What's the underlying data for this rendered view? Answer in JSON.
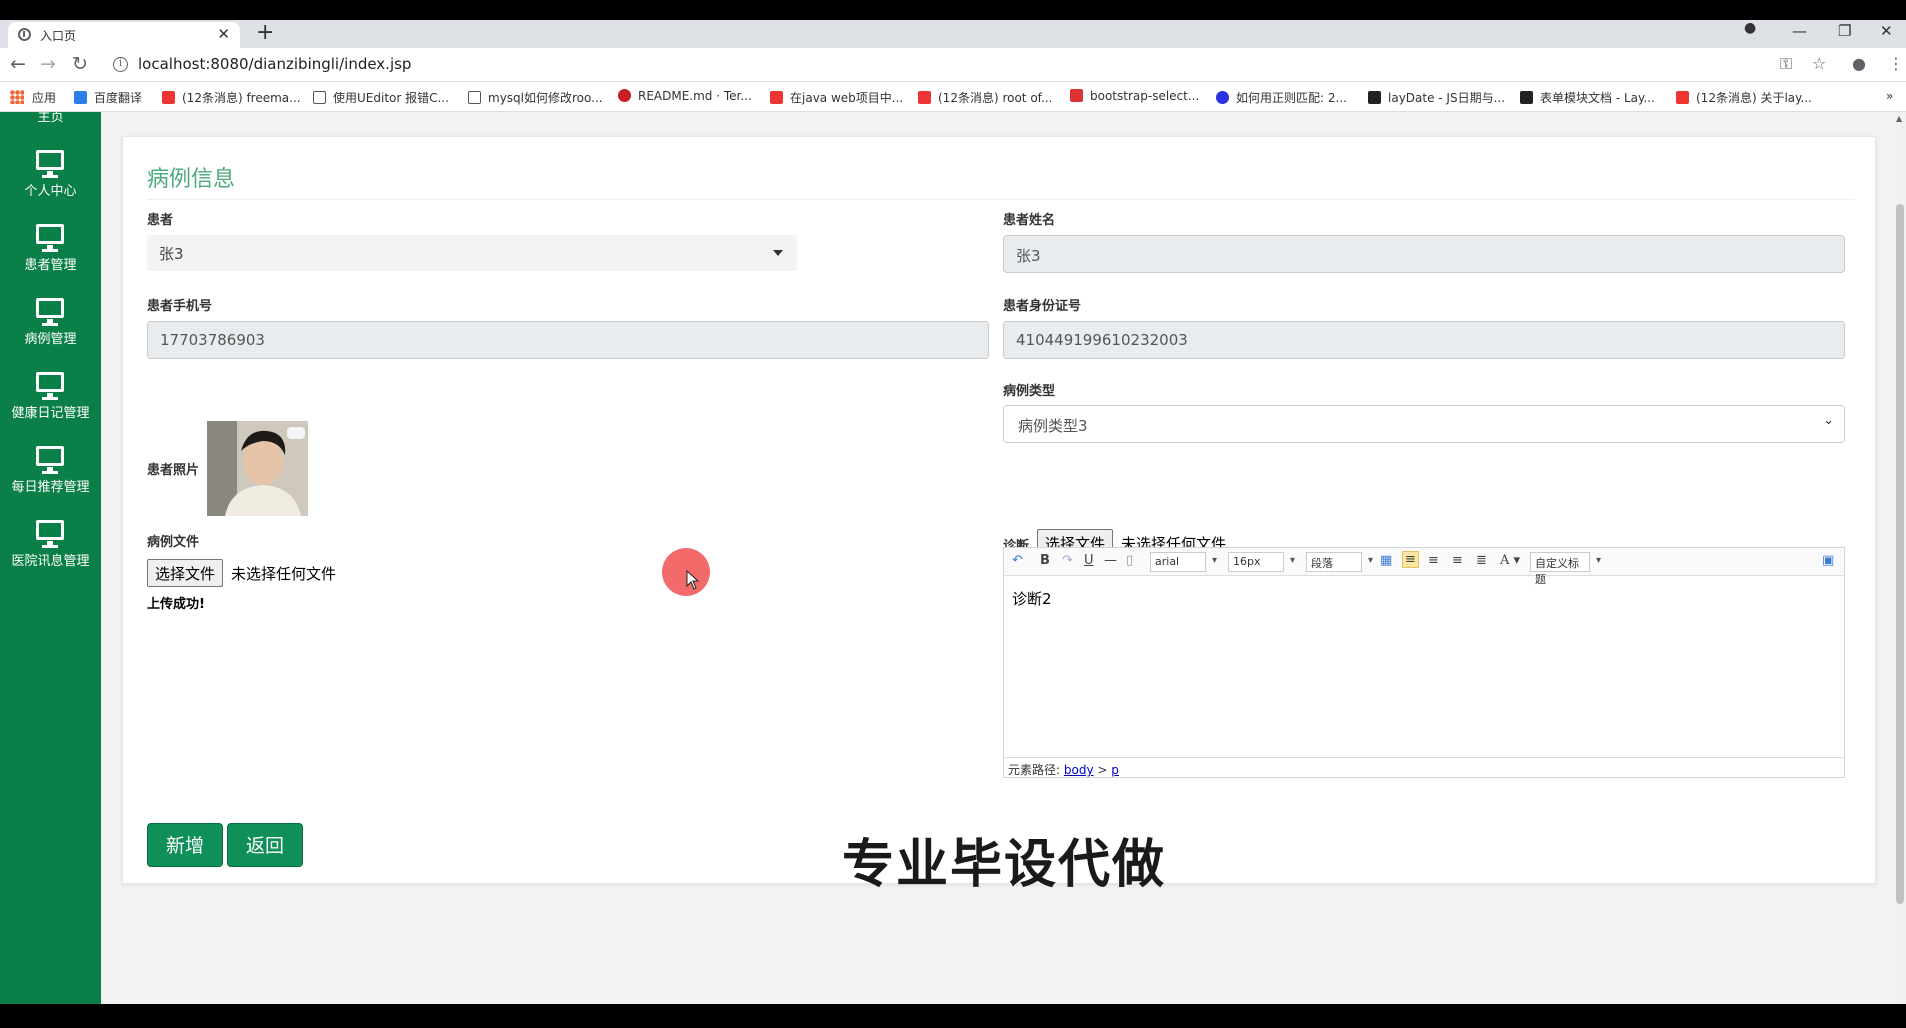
{
  "browser": {
    "tab_title": "入口页",
    "close_glyph": "✕",
    "new_tab_glyph": "+",
    "url": "localhost:8080/dianzibingli/index.jsp",
    "window_controls": [
      "—",
      "❐",
      "✕"
    ],
    "bookmarks": [
      {
        "label": "应用",
        "icon": "apps-icon"
      },
      {
        "label": "百度翻译",
        "icon": "baidu-translate-icon",
        "color": "#2b7de9"
      },
      {
        "label": "(12条消息) freema...",
        "icon": "csdn-icon",
        "color": "#e33"
      },
      {
        "label": "使用UEditor 报错C...",
        "icon": "fork-icon",
        "color": "#555"
      },
      {
        "label": "mysql如何修改roo...",
        "icon": "fork-icon",
        "color": "#555"
      },
      {
        "label": "README.md · Ter...",
        "icon": "gitee-icon",
        "color": "#c71d23"
      },
      {
        "label": "在java web项目中...",
        "icon": "csdn-icon",
        "color": "#e33"
      },
      {
        "label": "(12条消息) root of...",
        "icon": "csdn-icon",
        "color": "#e33"
      },
      {
        "label": "bootstrap-select...",
        "icon": "runoob-icon",
        "color": "#d33"
      },
      {
        "label": "如何用正则匹配: 2...",
        "icon": "baidu-icon",
        "color": "#2932e1"
      },
      {
        "label": "layDate - JS日期与...",
        "icon": "layui-icon",
        "color": "#222"
      },
      {
        "label": "表单模块文档 - Lay...",
        "icon": "layui-icon",
        "color": "#222"
      },
      {
        "label": "(12条消息) 关于lay...",
        "icon": "csdn-icon",
        "color": "#e33"
      }
    ],
    "more_glyph": "»"
  },
  "sidebar": {
    "top_partial": "主页",
    "items": [
      {
        "label": "个人中心",
        "icon": "monitor-icon"
      },
      {
        "label": "患者管理",
        "icon": "monitor-icon"
      },
      {
        "label": "病例管理",
        "icon": "monitor-icon"
      },
      {
        "label": "健康日记管理",
        "icon": "monitor-icon"
      },
      {
        "label": "每日推荐管理",
        "icon": "monitor-icon"
      },
      {
        "label": "医院讯息管理",
        "icon": "monitor-icon"
      }
    ]
  },
  "form": {
    "title": "病例信息",
    "patient": {
      "label": "患者",
      "value": "张3"
    },
    "patient_name": {
      "label": "患者姓名",
      "value": "张3"
    },
    "phone": {
      "label": "患者手机号",
      "value": "17703786903"
    },
    "id_card": {
      "label": "患者身份证号",
      "value": "410449199610232003"
    },
    "photo": {
      "label": "患者照片"
    },
    "case_type": {
      "label": "病例类型",
      "value": "病例类型3"
    },
    "case_file": {
      "label": "病例文件",
      "button": "选择文件",
      "status": "未选择任何文件",
      "result": "上传成功!"
    },
    "diagnosis": {
      "label": "诊断",
      "button": "选择文件",
      "status": "未选择任何文件",
      "toolbar": {
        "font": "arial",
        "size": "16px",
        "paragraph": "段落",
        "custom": "自定义标题"
      },
      "content": "诊断2",
      "path_label": "元素路径:",
      "path_body": "body",
      "path_sep": ">",
      "path_p": "p"
    },
    "add_button": "新增",
    "back_button": "返回"
  },
  "watermark": "专业毕设代做",
  "colors": {
    "sidebar": "#0a7f47",
    "accent": "#4bab7b",
    "button": "#0f8f5a"
  }
}
